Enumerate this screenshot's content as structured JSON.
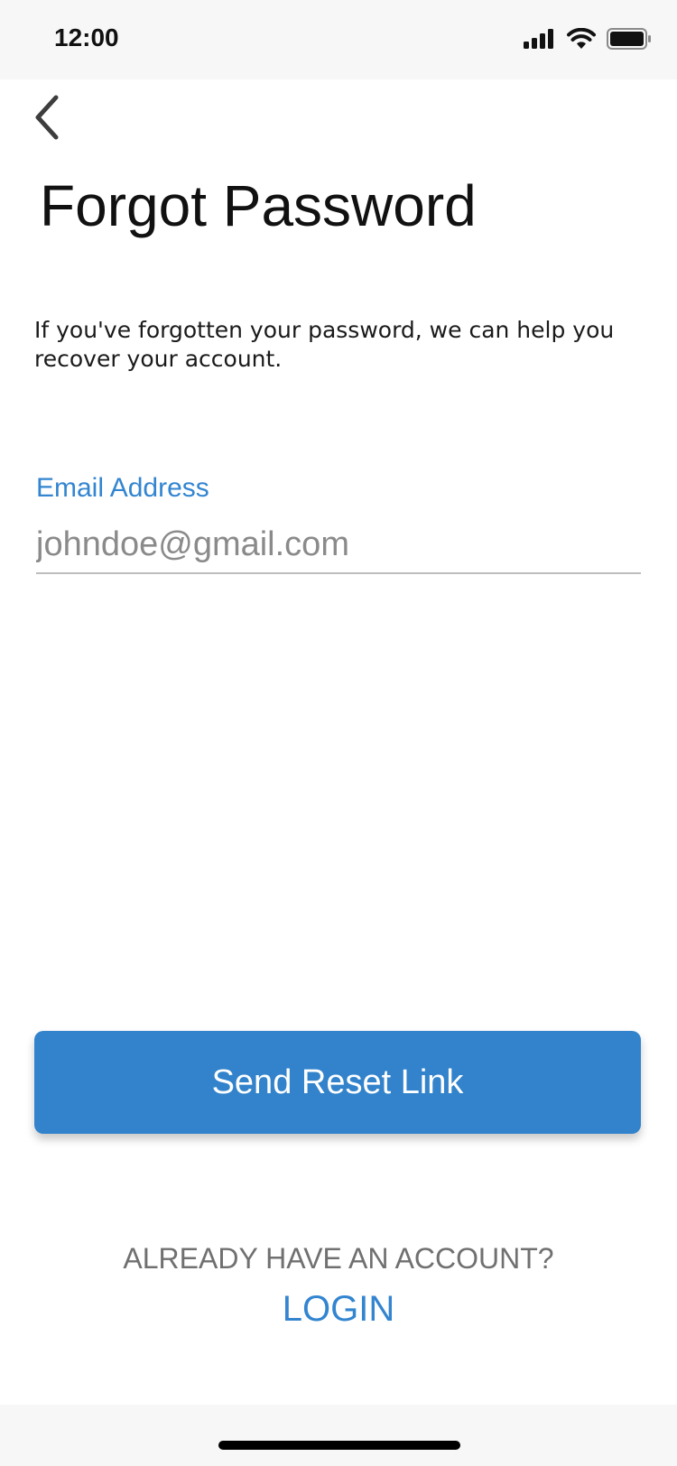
{
  "status_bar": {
    "time": "12:00",
    "icons": [
      "cellular-signal-icon",
      "wifi-icon",
      "battery-icon"
    ]
  },
  "nav": {
    "back_icon": "chevron-left-icon"
  },
  "page": {
    "title": "Forgot Password",
    "description": "If you've forgotten your password, we can help you recover your account."
  },
  "form": {
    "email_label": "Email Address",
    "email_placeholder": "johndoe@gmail.com",
    "email_value": ""
  },
  "actions": {
    "send_label": "Send Reset Link"
  },
  "footer": {
    "prompt": "ALREADY HAVE AN ACCOUNT?",
    "login_label": "LOGIN"
  },
  "colors": {
    "accent": "#3385d0",
    "button": "#3283cb",
    "muted_text": "#707070"
  }
}
